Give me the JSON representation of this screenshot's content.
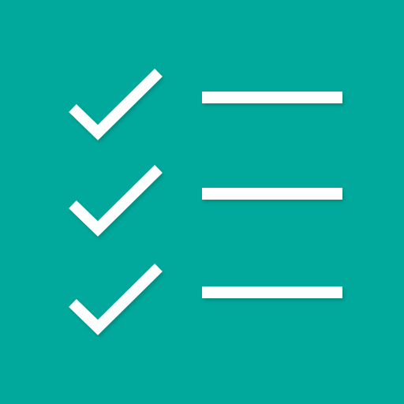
{
  "icon": {
    "name": "checklist-icon",
    "background_color": "#00a99c",
    "foreground_color": "#ffffff",
    "shadow_color": "#007d73"
  },
  "items": [
    {
      "checked": true,
      "icon": "check-icon"
    },
    {
      "checked": true,
      "icon": "check-icon"
    },
    {
      "checked": true,
      "icon": "check-icon"
    }
  ]
}
